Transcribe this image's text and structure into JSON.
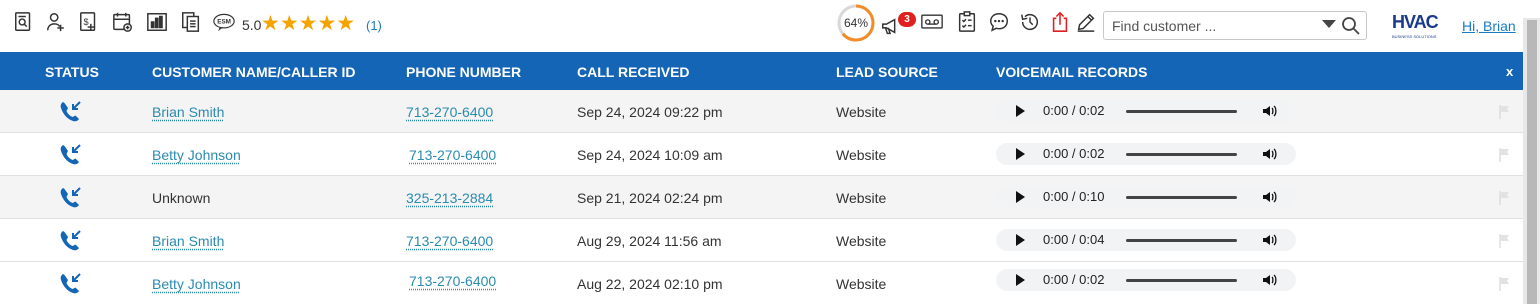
{
  "toolbar": {
    "icons": [
      "call-log-search-icon",
      "add-user-icon",
      "add-invoice-icon",
      "schedule-calendar-icon",
      "reports-chart-icon",
      "documents-icon",
      "esm-icon"
    ],
    "esm_label": "ESM",
    "rating_value": "5.0",
    "stars": "★★★★★",
    "rating_count": "(1)",
    "progress_label": "64%",
    "progress_value": 0.64,
    "notification_badge": "3",
    "search_placeholder": "Find customer ...",
    "logo_text": "HVAC",
    "logo_subtext": "BUSINESS SOLUTIONS",
    "greeting": "Hi, Brian"
  },
  "table": {
    "columns": {
      "status": "STATUS",
      "customer": "CUSTOMER NAME/CALLER ID",
      "phone": "PHONE NUMBER",
      "call_received": "CALL RECEIVED",
      "lead_source": "LEAD SOURCE",
      "voicemail": "VOICEMAIL RECORDS"
    },
    "close_label": "x",
    "rows": [
      {
        "customer": "Brian Smith",
        "customer_link": true,
        "phone": "713-270-6400",
        "received": "Sep 24, 2024 09:22 pm",
        "source": "Website",
        "voicemail_time": "0:00 / 0:02"
      },
      {
        "customer": "Betty Johnson",
        "customer_link": true,
        "phone": "713-270-6400",
        "received": "Sep 24, 2024 10:09 am",
        "source": "Website",
        "voicemail_time": "0:00 / 0:02"
      },
      {
        "customer": "Unknown",
        "customer_link": false,
        "phone": "325-213-2884",
        "received": "Sep 21, 2024 02:24 pm",
        "source": "Website",
        "voicemail_time": "0:00 / 0:10"
      },
      {
        "customer": "Brian Smith",
        "customer_link": true,
        "phone": "713-270-6400",
        "received": "Aug 29, 2024 11:56 am",
        "source": "Website",
        "voicemail_time": "0:00 / 0:04"
      },
      {
        "customer": "Betty Johnson",
        "customer_link": true,
        "phone": "713-270-6400",
        "received": "Aug 22, 2024 02:10 pm",
        "source": "Website",
        "voicemail_time": "0:00 / 0:02"
      }
    ]
  },
  "colors": {
    "header_bg": "#1565b7",
    "link": "#2a8bb0",
    "status_icon": "#1565b7",
    "star": "#f5a300",
    "progress": "#f28c28",
    "badge": "#e02020"
  }
}
